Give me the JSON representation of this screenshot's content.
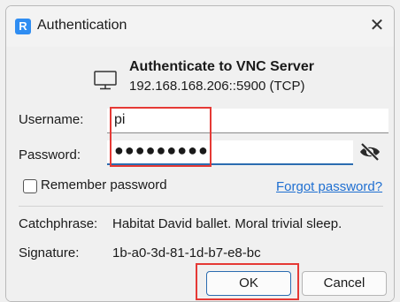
{
  "window": {
    "title": "Authentication",
    "app_icon_glyph": "R"
  },
  "header": {
    "heading": "Authenticate to VNC Server",
    "server": "192.168.168.206::5900 (TCP)"
  },
  "form": {
    "username_label": "Username:",
    "username_value": "pi",
    "password_label": "Password:",
    "password_mask": "●●●●●●●●●",
    "remember_label": "Remember password",
    "remember_checked": false,
    "forgot_link": "Forgot password?"
  },
  "info": {
    "catchphrase_label": "Catchphrase:",
    "catchphrase_value": "Habitat David ballet. Moral trivial sleep.",
    "signature_label": "Signature:",
    "signature_value": "1b-a0-3d-81-1d-b7-e8-bc"
  },
  "buttons": {
    "ok": "OK",
    "cancel": "Cancel"
  },
  "icons": {
    "close": "close-icon",
    "monitor": "monitor-icon",
    "visibility": "eye-off-icon",
    "app": "realvnc-icon"
  },
  "colors": {
    "accent": "#2b6cb0",
    "link": "#1f6fd1",
    "annotation": "#e53935",
    "app_icon": "#2f8df2"
  }
}
